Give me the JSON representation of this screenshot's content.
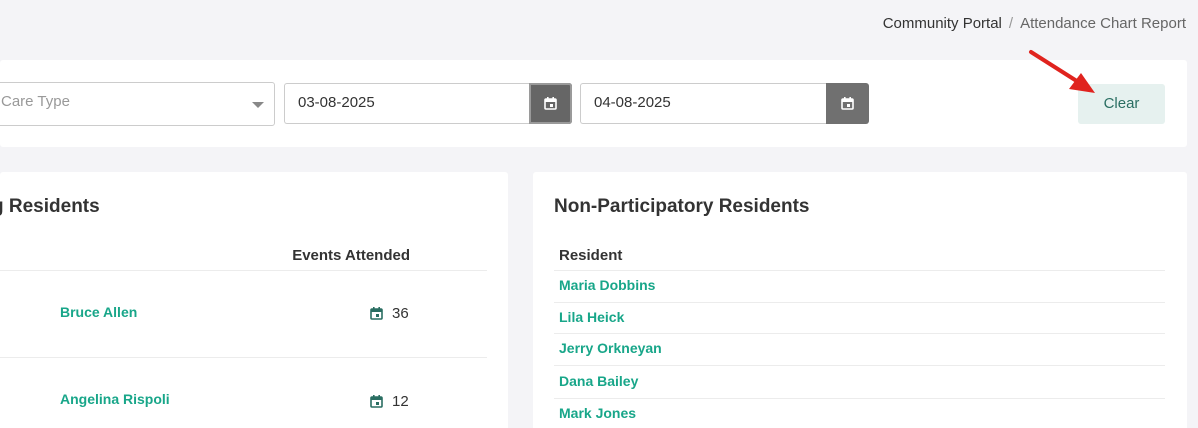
{
  "breadcrumb": {
    "root": "Community Portal",
    "separator": "/",
    "current": "Attendance Chart Report"
  },
  "filters": {
    "care_type_placeholder": "Care Type",
    "start_date": "03-08-2025",
    "end_date": "04-08-2025",
    "clear_label": "Clear"
  },
  "participating": {
    "title": "g Residents",
    "col_events": "Events Attended",
    "rows": [
      {
        "name": "Bruce Allen",
        "count": "36"
      },
      {
        "name": "Angelina Rispoli",
        "count": "12"
      }
    ]
  },
  "non_participating": {
    "title": "Non-Participatory Residents",
    "col_resident": "Resident",
    "rows": [
      {
        "name": "Maria Dobbins"
      },
      {
        "name": "Lila Heick"
      },
      {
        "name": "Jerry Orkneyan"
      },
      {
        "name": "Dana Bailey"
      },
      {
        "name": "Mark Jones"
      }
    ]
  },
  "colors": {
    "accent_green": "#18a689",
    "clear_bg": "#e6f1ef",
    "date_button": "#707070",
    "arrow_red": "#e0231e"
  },
  "icons": {
    "date_button": "calendar-icon",
    "event_count": "calendar-icon",
    "select_caret": "chevron-down-icon",
    "annotation": "red-arrow-icon"
  }
}
